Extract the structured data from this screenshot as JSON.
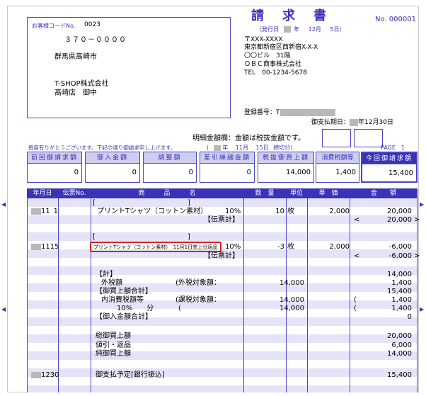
{
  "title": "請　求　書",
  "doc_no": "No. 000001",
  "issue_date": {
    "label_open": "（発行日",
    "year_suffix": "年",
    "month": "12月",
    "day": "5日）"
  },
  "customer": {
    "code_label": "お客様コードNo.",
    "code": "0023",
    "postal": "３７０－００００",
    "address": "群馬県高崎市",
    "company": "T-SHOP株式会社",
    "branch": "高崎店　御中"
  },
  "sender": {
    "postal": "〒XXX-XXXX",
    "address": "東京都新宿区西新宿X-X-X",
    "building": "〇〇ビル　31階",
    "company": "ＯＢＣ商事株式会社",
    "tel": "TEL　00-1234-5678"
  },
  "registration_label": "登録番号：T",
  "due_label": "御支払期日：",
  "due_date": "年12月30日",
  "tax_note": "明細金額欄：金額は税抜金額です。",
  "thanks": "毎度有りがとうございます。下記の通り御請求申し上げます。",
  "cutoff": {
    "open": "(",
    "year": "年",
    "month": "11月",
    "day": "15日",
    "close": "締切分)"
  },
  "page": "PAGE　1",
  "summary": [
    {
      "label": "前回御請求額",
      "value": "0"
    },
    {
      "label": "御入金額",
      "value": "0"
    },
    {
      "label": "調整額",
      "value": "0"
    },
    {
      "label": "差引繰越金額",
      "value": "0"
    },
    {
      "label": "税抜御買上額",
      "value": "14,000"
    },
    {
      "label": "消費税額等",
      "value": "1,400"
    },
    {
      "label": "今回御請求額",
      "value": "15,400"
    }
  ],
  "columns": [
    "年月日",
    "伝票No.",
    "商　　　品　　　名",
    "数　量",
    "単位",
    "単　価",
    "金　　額"
  ],
  "rows": {
    "r1_bracket": "[　　　　　　　　　　　　　]",
    "r1_date": "11",
    "r1_no": "1",
    "r1_name": "プリントTシャツ（コットン素材）",
    "r1_tax": "10%",
    "r1_qty": "10",
    "r1_unit": "枚",
    "r1_price": "2,000",
    "r1_amount": "20,000",
    "r1_total_label": "【伝票計】",
    "r1_total_open": "<",
    "r1_total_amount": "20,000",
    "r1_total_close": ">",
    "r2_bracket": "[　　　　　　　　　　　　　]",
    "r2_date": "1115",
    "r2_name": "プリントTシャツ（コットン素材）　11月1日売上分返品",
    "r2_tax": "10%",
    "r2_qty": "-3",
    "r2_unit": "枚",
    "r2_price": "2,000",
    "r2_amount": "-6,000",
    "r2_total_label": "【伝票計】",
    "r2_total_open": "<",
    "r2_total_amount": "-6,000",
    "r2_total_close": ">",
    "total_head": "【計】",
    "total_amount": "14,000",
    "ext_tax": "外税額",
    "ext_tax_base_label": "(外税対象額：",
    "ext_tax_base": "14,000",
    "ext_tax_amount": "1,400",
    "purchase_total": "【御買上額合計】",
    "purchase_total_amount": "15,400",
    "int_tax": "内消費税額等",
    "int_tax_base_label": "(課税対象額：",
    "int_tax_base": "14,000",
    "int_tax_open": "(",
    "int_tax_amount": "1,400",
    "rate_label": "10%　　分",
    "rate_open": "(",
    "rate_base": "14,000",
    "rate_amount_open": "(",
    "rate_amount": "1,400",
    "paid_total": "【御入金額合計】",
    "paid_total_amount": "0",
    "gross": "総御買上額",
    "gross_amount": "20,000",
    "returns": "値引・返品",
    "returns_amount": "6,000",
    "net": "純御買上額",
    "net_amount": "14,000",
    "pay_date": "1230",
    "pay_plan": "御支払予定[銀行振込]",
    "pay_amount": "15,400"
  }
}
